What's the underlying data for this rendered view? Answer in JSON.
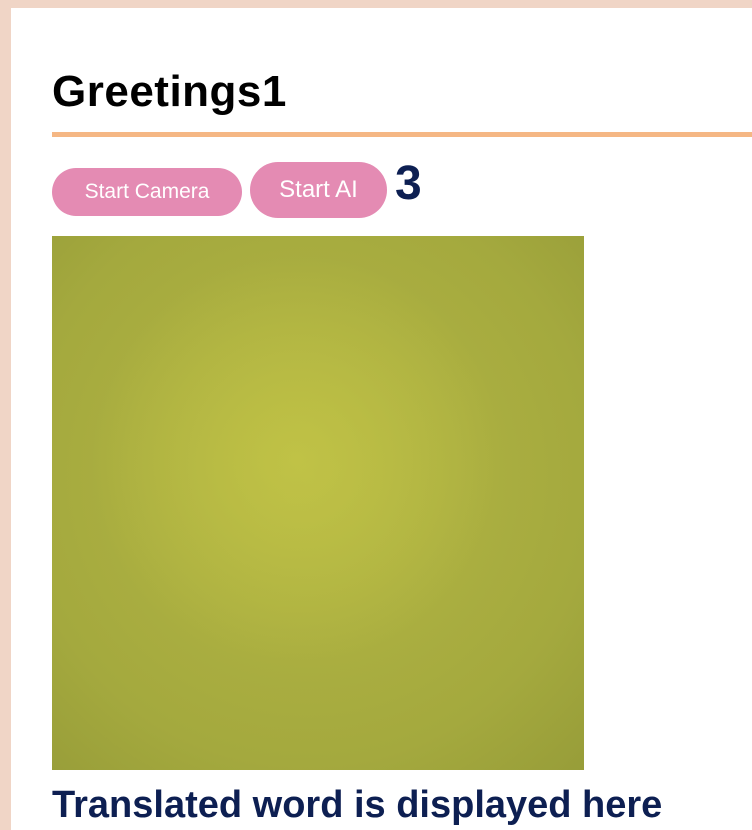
{
  "page": {
    "title": "Greetings1"
  },
  "controls": {
    "start_camera_label": "Start Camera",
    "start_ai_label": "Start AI",
    "counter_value": "3"
  },
  "result": {
    "text": "Translated word is displayed here"
  },
  "colors": {
    "page_background": "#f0d5c6",
    "panel_background": "#ffffff",
    "title_rule": "#f5b784",
    "button_background": "#e48bb3",
    "button_text": "#ffffff",
    "accent_text": "#0d1f52",
    "camera_feed": "#a4a93e"
  }
}
